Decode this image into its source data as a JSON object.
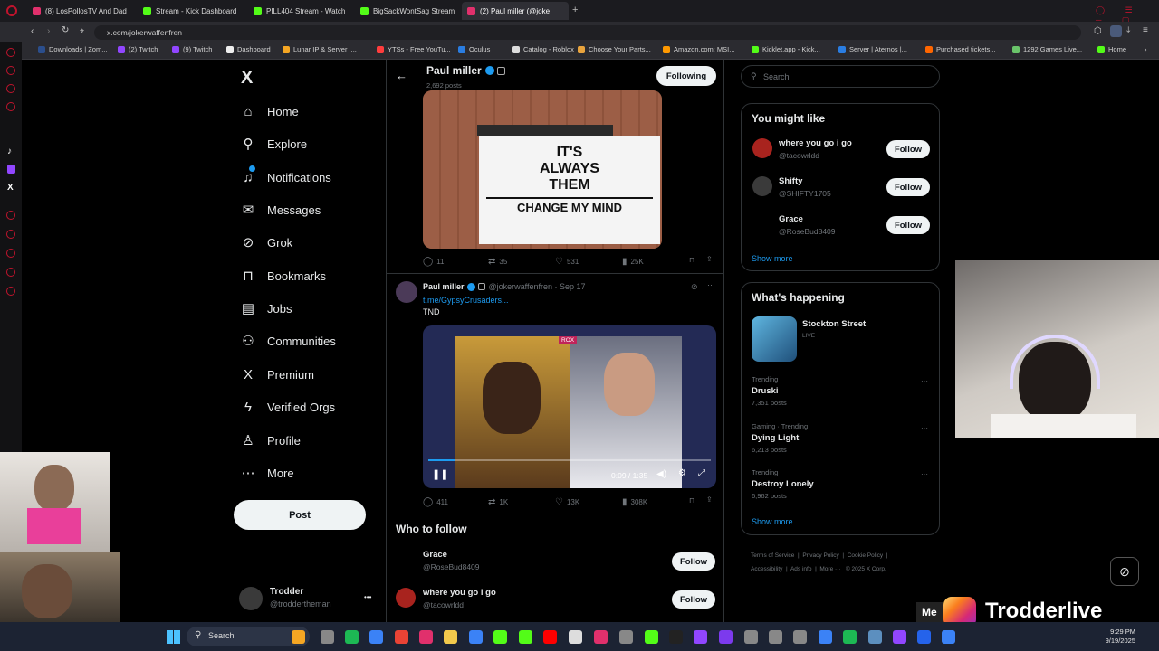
{
  "browser": {
    "tabs": [
      {
        "label": "(8) LosPollosTV And Dad",
        "color": "#e1306c"
      },
      {
        "label": "Stream - Kick Dashboard",
        "color": "#53fc18"
      },
      {
        "label": "PILL404 Stream - Watch",
        "color": "#53fc18"
      },
      {
        "label": "BigSackWontSag Stream",
        "color": "#53fc18"
      },
      {
        "label": "(2) Paul miller (@joke",
        "color": "#e1306c"
      }
    ],
    "new_tab": "+",
    "url": "x.com/jokerwaffenfren",
    "bookmarks": [
      "Downloads | Zom...",
      "(2) Twitch",
      "(9) Twitch",
      "Dashboard",
      "Lunar IP & Server I...",
      "YTSs - Free YouTu...",
      "Oculus",
      "Catalog - Roblox",
      "Choose Your Parts...",
      "Amazon.com: MSI...",
      "Kicklet.app - Kick...",
      "Server | Aternos |...",
      "Purchased tickets...",
      "1292 Games Live...",
      "Home"
    ]
  },
  "nav": {
    "logo": "X",
    "items": [
      {
        "label": "Home",
        "icon": "⌂"
      },
      {
        "label": "Explore",
        "icon": "⚲"
      },
      {
        "label": "Notifications",
        "icon": "♫"
      },
      {
        "label": "Messages",
        "icon": "✉"
      },
      {
        "label": "Grok",
        "icon": "⊘"
      },
      {
        "label": "Bookmarks",
        "icon": "⊓"
      },
      {
        "label": "Jobs",
        "icon": "▤"
      },
      {
        "label": "Communities",
        "icon": "⚇"
      },
      {
        "label": "Premium",
        "icon": "X"
      },
      {
        "label": "Verified Orgs",
        "icon": "ϟ"
      },
      {
        "label": "Profile",
        "icon": "♙"
      },
      {
        "label": "More",
        "icon": "⋯"
      }
    ],
    "post_label": "Post",
    "account": {
      "name": "Trodder",
      "handle": "@troddertheman",
      "more": "•••"
    }
  },
  "profile_header": {
    "name": "Paul miller",
    "posts": "2,692 posts",
    "following_label": "Following",
    "back": "←"
  },
  "tweet1": {
    "meme_lines": [
      "IT'S",
      "ALWAYS",
      "THEM"
    ],
    "meme_bottom": "CHANGE MY MIND",
    "replies": "11",
    "reposts": "35",
    "likes": "531",
    "views": "25K"
  },
  "tweet2": {
    "name": "Paul miller",
    "handle": "@jokerwaffenfren · Sep 17",
    "link": "t.me/GypsyCrusaders...",
    "text": "TND",
    "video_time": "0:09 / 1:35",
    "video_badge": "ROX",
    "replies": "411",
    "reposts": "1K",
    "likes": "13K",
    "views": "308K"
  },
  "who_to_follow": {
    "title": "Who to follow",
    "people": [
      {
        "name": "Grace",
        "handle": "@RoseBud8409",
        "button": "Follow"
      },
      {
        "name": "where you go i go",
        "handle": "@tacowrldd",
        "button": "Follow"
      }
    ]
  },
  "search": {
    "placeholder": "Search"
  },
  "you_might_like": {
    "title": "You might like",
    "people": [
      {
        "name": "where you go i go",
        "handle": "@tacowrldd",
        "button": "Follow"
      },
      {
        "name": "Shifty",
        "handle": "@SHIFTY1705",
        "button": "Follow"
      },
      {
        "name": "Grace",
        "handle": "@RoseBud8409",
        "button": "Follow"
      }
    ],
    "show_more": "Show more"
  },
  "whats_happening": {
    "title": "What's happening",
    "live": {
      "name": "Stockton Street",
      "tag": "LIVE"
    },
    "trends": [
      {
        "context": "Trending",
        "name": "Druski",
        "posts": "7,351 posts"
      },
      {
        "context": "Gaming · Trending",
        "name": "Dying Light",
        "posts": "6,213 posts"
      },
      {
        "context": "Trending",
        "name": "Destroy Lonely",
        "posts": "6,962 posts"
      }
    ],
    "show_more": "Show more"
  },
  "footer": {
    "links": [
      "Terms of Service",
      "Privacy Policy",
      "Cookie Policy",
      "Accessibility",
      "Ads info",
      "More ···",
      "© 2025 X Corp."
    ]
  },
  "overlay": {
    "brand": "Trodderlive",
    "prefix": "Me"
  },
  "taskbar": {
    "search": "Search",
    "time": "9:29 PM",
    "date": "9/19/2025"
  }
}
